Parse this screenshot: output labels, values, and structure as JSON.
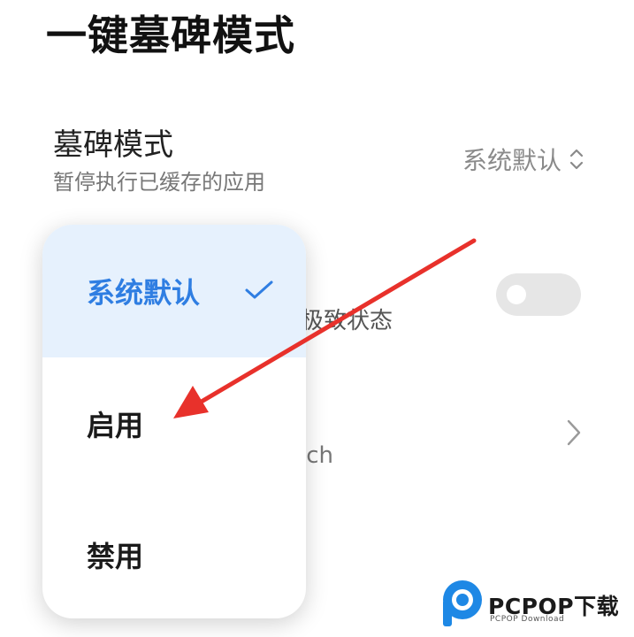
{
  "page": {
    "title": "一键墓碑模式"
  },
  "tombstone_row": {
    "title": "墓碑模式",
    "subtitle": "暂停执行已缓存的应用",
    "value": "系统默认",
    "value_icon": "updown-icon"
  },
  "background_rows": {
    "row2_text": "极致状态",
    "row2_toggle_on": false,
    "row3_text": "tch",
    "row3_icon": "chevron-right-icon"
  },
  "popup_menu": {
    "options": [
      {
        "label": "系统默认",
        "selected": true
      },
      {
        "label": "启用",
        "selected": false
      },
      {
        "label": "禁用",
        "selected": false
      }
    ],
    "check_icon": "check-icon"
  },
  "annotation": {
    "arrow_color": "#e8312b"
  },
  "colors": {
    "accent": "#2f7ee2",
    "selected_bg": "#e6f1fd",
    "toggle_off": "#e6e6e6"
  },
  "watermark": {
    "brand": "PCPOP下载",
    "sub": "PCPOP Download"
  }
}
